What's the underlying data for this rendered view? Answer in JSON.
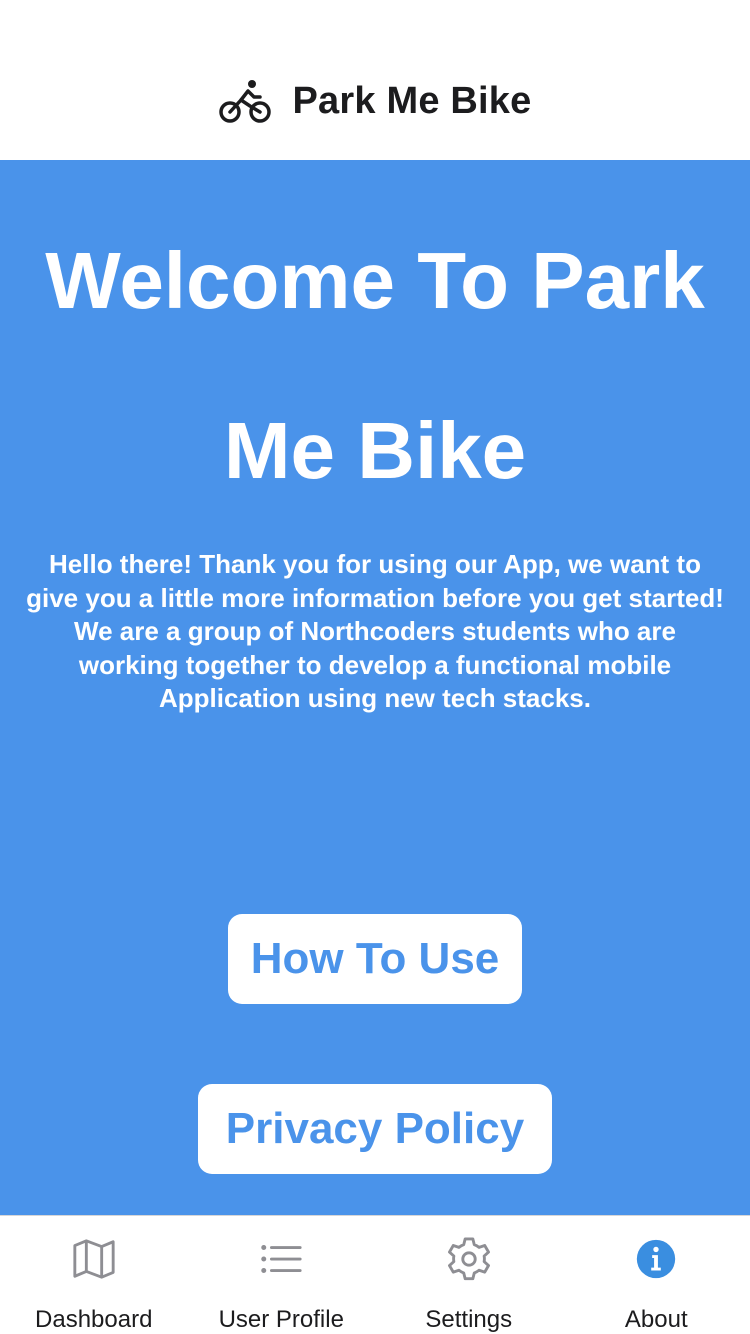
{
  "header": {
    "title": "Park Me Bike",
    "icon": "bike-icon"
  },
  "main": {
    "background_color": "#4a93ea",
    "welcome_title": "Welcome To Park Me Bike",
    "intro_text": "Hello there! Thank you for using our App, we want to give you a little more information before you get started! We are a group of Northcoders students who are working together to develop a functional mobile Application using new tech stacks.",
    "buttons": [
      {
        "label": "How To Use"
      },
      {
        "label": "Privacy Policy"
      }
    ]
  },
  "tabbar": {
    "active_color": "#3a8ee0",
    "tabs": [
      {
        "label": "Dashboard",
        "icon": "map-icon",
        "active": false
      },
      {
        "label": "User Profile",
        "icon": "list-icon",
        "active": false
      },
      {
        "label": "Settings",
        "icon": "gear-icon",
        "active": false
      },
      {
        "label": "About",
        "icon": "info-icon",
        "active": true
      }
    ]
  }
}
